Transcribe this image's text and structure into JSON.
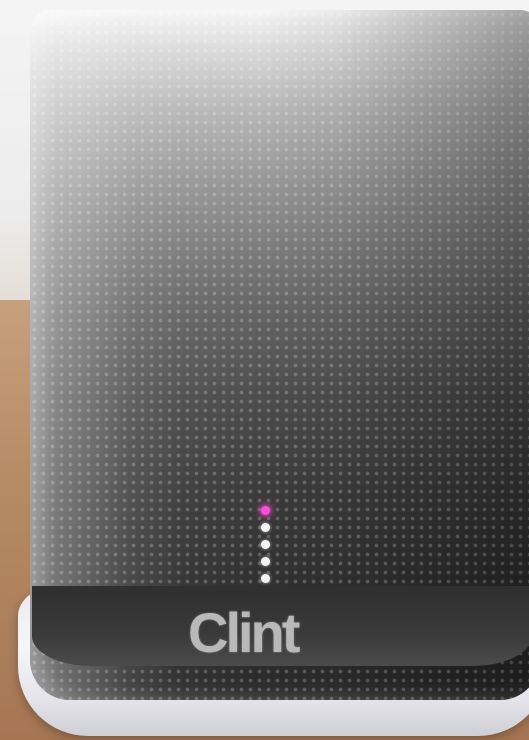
{
  "photo": {
    "subject": "speaker",
    "brand_logo": "Clint",
    "led_count": 5,
    "active_led_color": "#ff4dd7",
    "inactive_led_color": "#f4f4f4"
  }
}
